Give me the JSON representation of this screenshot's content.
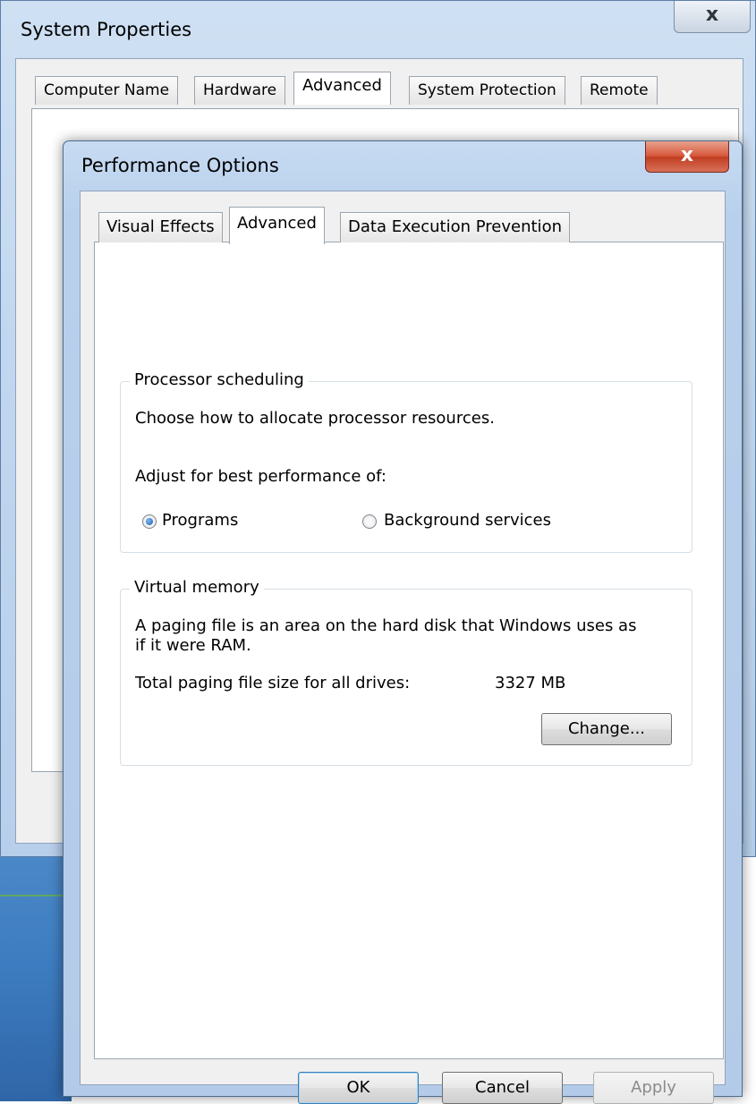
{
  "system_properties": {
    "title": "System Properties",
    "close_glyph": "x",
    "tabs": [
      {
        "label": "Computer Name"
      },
      {
        "label": "Hardware"
      },
      {
        "label": "Advanced"
      },
      {
        "label": "System Protection"
      },
      {
        "label": "Remote"
      }
    ],
    "active_tab": "Advanced"
  },
  "performance_options": {
    "title": "Performance Options",
    "close_glyph": "x",
    "tabs": [
      {
        "label": "Visual Effects"
      },
      {
        "label": "Advanced"
      },
      {
        "label": "Data Execution Prevention"
      }
    ],
    "active_tab": "Advanced",
    "processor_scheduling": {
      "legend": "Processor scheduling",
      "description": "Choose how to allocate processor resources.",
      "adjust_label": "Adjust for best performance of:",
      "options": [
        {
          "label": "Programs",
          "checked": true
        },
        {
          "label": "Background services",
          "checked": false
        }
      ]
    },
    "virtual_memory": {
      "legend": "Virtual memory",
      "description_line1": "A paging file is an area on the hard disk that Windows uses as",
      "description_line2": "if it were RAM.",
      "total_label": "Total paging file size for all drives:",
      "total_value": "3327 MB",
      "change_button": "Change..."
    },
    "buttons": {
      "ok": "OK",
      "cancel": "Cancel",
      "apply": "Apply"
    }
  },
  "colors": {
    "title_bar": "#c2d7ef",
    "close_red": "#c13e22",
    "radio_blue": "#1f5fb0"
  }
}
